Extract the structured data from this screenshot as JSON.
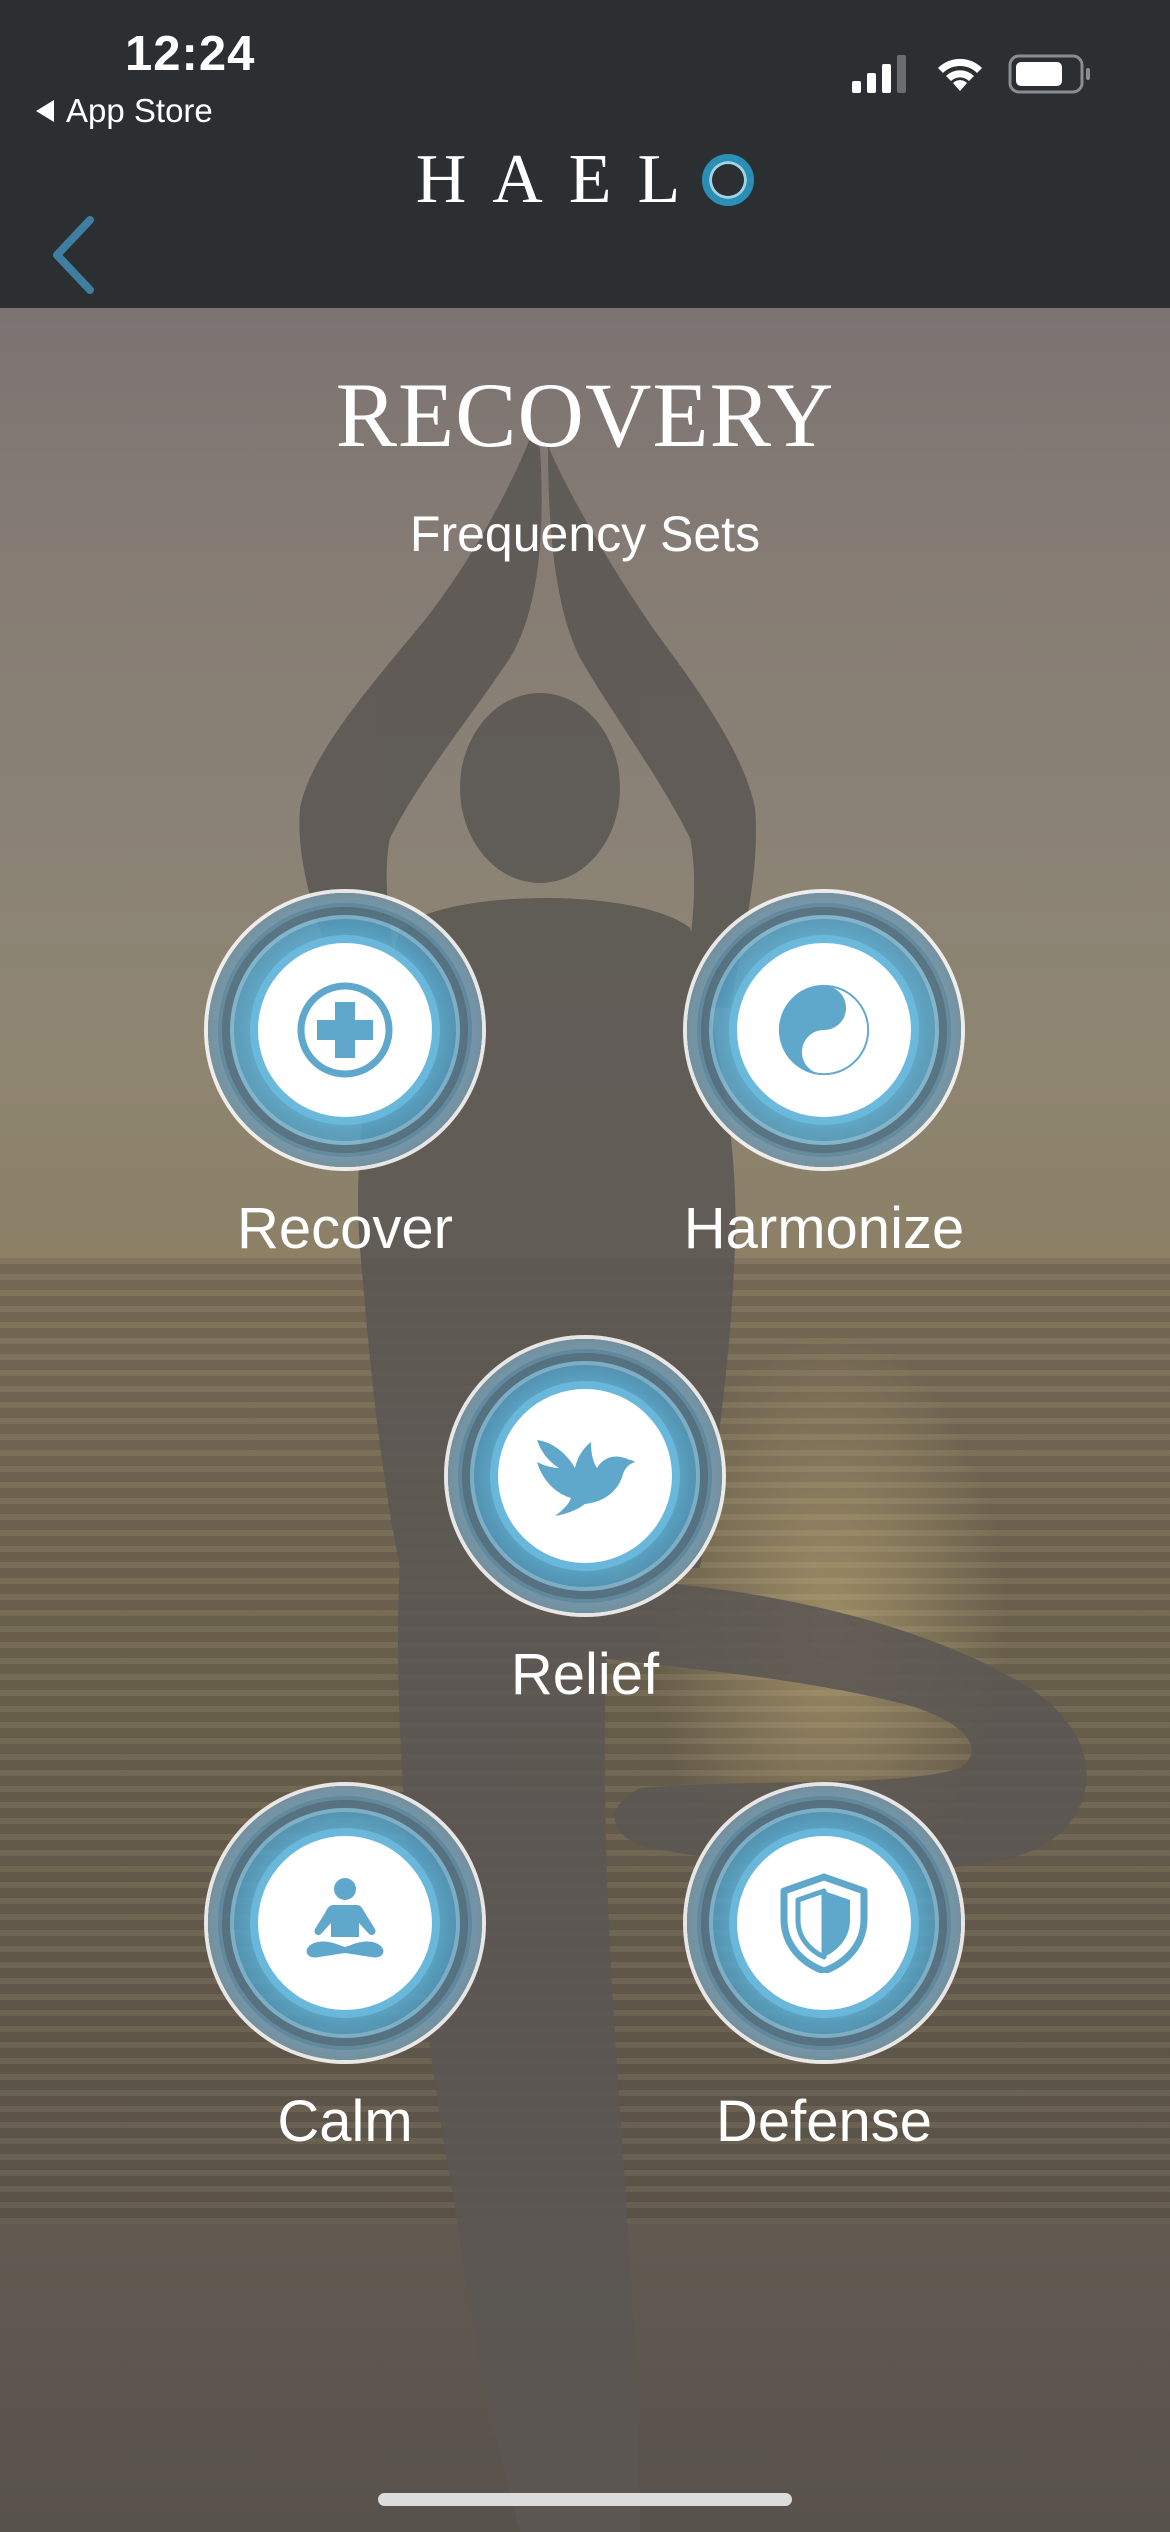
{
  "status_bar": {
    "time": "12:24",
    "back_app": "App Store"
  },
  "header": {
    "brand": "HAEL",
    "brand_last_letter": "O"
  },
  "page": {
    "title": "RECOVERY",
    "subtitle": "Frequency Sets"
  },
  "sets": [
    {
      "label": "Recover",
      "icon": "medical-cross-icon"
    },
    {
      "label": "Harmonize",
      "icon": "yin-yang-icon"
    },
    {
      "label": "Relief",
      "icon": "dove-icon"
    },
    {
      "label": "Calm",
      "icon": "meditation-icon"
    },
    {
      "label": "Defense",
      "icon": "shield-icon"
    }
  ],
  "colors": {
    "header": "#2c2f32",
    "accent": "#5fa8cc",
    "back_arrow": "#3f7ea1"
  }
}
